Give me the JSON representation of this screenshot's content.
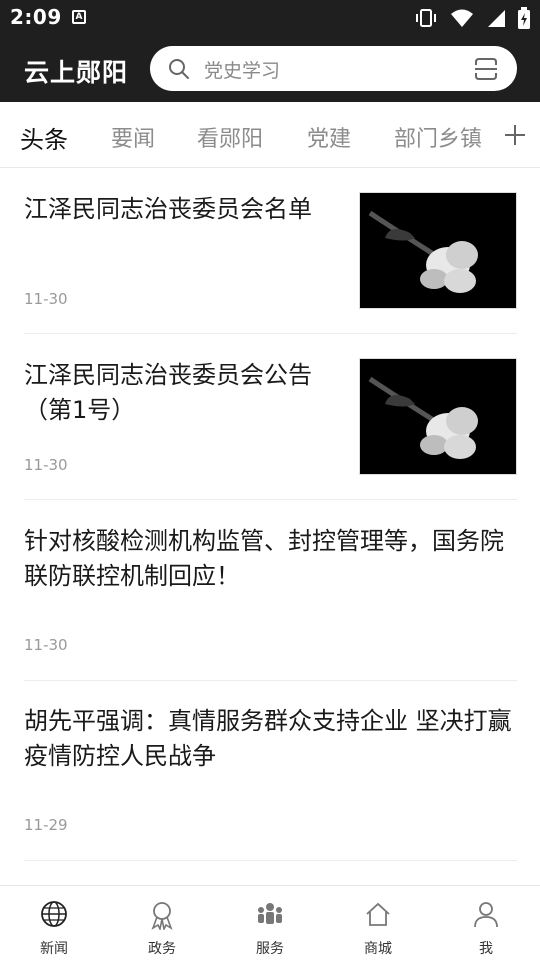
{
  "status_bar": {
    "time": "2:09",
    "notification_glyph": "A"
  },
  "header": {
    "app_title": "云上郧阳",
    "search_placeholder": "党史学习"
  },
  "tabs": [
    {
      "label": "头条",
      "active": true
    },
    {
      "label": "要闻",
      "active": false
    },
    {
      "label": "看郧阳",
      "active": false
    },
    {
      "label": "党建",
      "active": false
    },
    {
      "label": "部门乡镇",
      "active": false
    }
  ],
  "news": [
    {
      "title": "江泽民同志治丧委员会名单",
      "date": "11-30",
      "has_image": true
    },
    {
      "title": "江泽民同志治丧委员会公告（第1号）",
      "date": "11-30",
      "has_image": true
    },
    {
      "title": "针对核酸检测机构监管、封控管理等，国务院联防联控机制回应！",
      "date": "11-30",
      "has_image": false
    },
    {
      "title": "胡先平强调：真情服务群众支持企业 坚决打赢疫情防控人民战争",
      "date": "11-29",
      "has_image": false
    }
  ],
  "bottom_nav": [
    {
      "label": "新闻",
      "icon": "globe-icon"
    },
    {
      "label": "政务",
      "icon": "ribbon-icon"
    },
    {
      "label": "服务",
      "icon": "people-icon"
    },
    {
      "label": "商城",
      "icon": "home-icon"
    },
    {
      "label": "我",
      "icon": "user-icon"
    }
  ],
  "colors": {
    "header_bg": "#1f1f1f",
    "active_tab": "#111111",
    "inactive_tab": "#8c8c8c"
  }
}
